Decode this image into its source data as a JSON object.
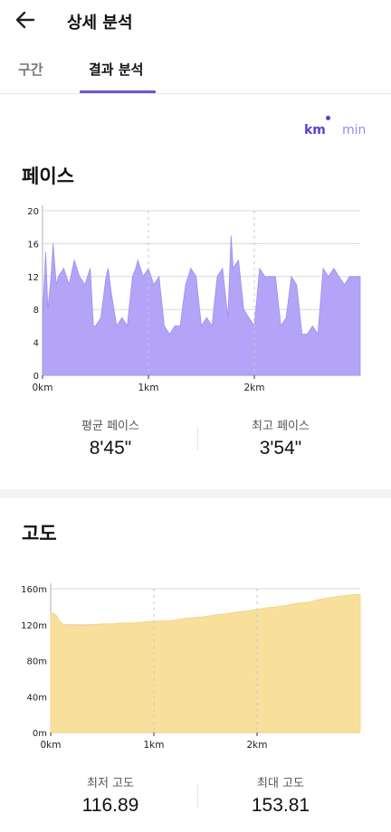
{
  "header": {
    "title": "상세 분석"
  },
  "tabs": [
    {
      "label": "구간",
      "selected": false
    },
    {
      "label": "결과 분석",
      "selected": true
    }
  ],
  "units": {
    "km": "km",
    "min": "min",
    "selected": "km"
  },
  "pace": {
    "title": "페이스",
    "avg_label": "평균 페이스",
    "avg_value": "8'45\"",
    "best_label": "최고 페이스",
    "best_value": "3'54\""
  },
  "elevation": {
    "title": "고도",
    "min_label": "최저 고도",
    "min_value": "116.89",
    "max_label": "최대 고도",
    "max_value": "153.81"
  },
  "colors": {
    "accent": "#6a55d8",
    "pace_fill": "#b4a4f7",
    "elevation_fill": "#f8e09c"
  },
  "chart_data": [
    {
      "type": "area",
      "title": "",
      "xlabel": "",
      "ylabel": "",
      "ylim": [
        0,
        20
      ],
      "xlim": [
        0,
        3.0
      ],
      "yticks": [
        "0",
        "4",
        "8",
        "12",
        "16",
        "20"
      ],
      "xticks": [
        "0km",
        "1km",
        "2km"
      ],
      "grid": true,
      "series": [
        {
          "x": [
            0.0,
            0.03,
            0.05,
            0.08,
            0.1,
            0.13,
            0.15,
            0.2,
            0.25,
            0.3,
            0.35,
            0.4,
            0.45,
            0.48,
            0.5,
            0.55,
            0.6,
            0.62,
            0.65,
            0.7,
            0.75,
            0.8,
            0.85,
            0.88,
            0.9,
            0.95,
            1.0,
            1.05,
            1.1,
            1.15,
            1.2,
            1.25,
            1.3,
            1.35,
            1.4,
            1.45,
            1.5,
            1.55,
            1.6,
            1.65,
            1.7,
            1.75,
            1.78,
            1.8,
            1.85,
            1.9,
            1.95,
            2.0,
            2.05,
            2.1,
            2.15,
            2.2,
            2.25,
            2.3,
            2.35,
            2.4,
            2.45,
            2.5,
            2.55,
            2.6,
            2.65,
            2.7,
            2.75,
            2.8,
            2.85,
            2.9,
            2.95,
            3.0
          ],
          "y": [
            7,
            15,
            8,
            12,
            16,
            11,
            12,
            13,
            11,
            14,
            12,
            11,
            13,
            6,
            6,
            7,
            12,
            13,
            10,
            6,
            7,
            6,
            12,
            13,
            14,
            12,
            13,
            11,
            12,
            6,
            5,
            6,
            6,
            11,
            13,
            12,
            6,
            7,
            6,
            12,
            13,
            7,
            17,
            13,
            14,
            8,
            7,
            6,
            13,
            12,
            12,
            12,
            6,
            7,
            12,
            11,
            5,
            5,
            6,
            5,
            13,
            12,
            13,
            12,
            11,
            12,
            12,
            12
          ]
        }
      ]
    },
    {
      "type": "area",
      "title": "",
      "xlabel": "",
      "ylabel": "",
      "ylim": [
        0,
        160
      ],
      "xlim": [
        0,
        3.0
      ],
      "yticks": [
        "0m",
        "40m",
        "80m",
        "120m",
        "160m"
      ],
      "xticks": [
        "0km",
        "1km",
        "2km"
      ],
      "grid": true,
      "series": [
        {
          "x": [
            0.0,
            0.05,
            0.1,
            0.15,
            0.2,
            0.3,
            0.4,
            0.5,
            0.6,
            0.7,
            0.8,
            0.9,
            1.0,
            1.1,
            1.2,
            1.3,
            1.4,
            1.5,
            1.6,
            1.7,
            1.8,
            1.9,
            2.0,
            2.1,
            2.2,
            2.3,
            2.4,
            2.5,
            2.6,
            2.7,
            2.8,
            2.9,
            3.0
          ],
          "y": [
            134,
            131,
            122,
            119,
            120,
            119,
            120,
            121,
            121,
            122,
            122,
            123,
            124,
            124,
            125,
            127,
            128,
            129,
            131,
            132,
            134,
            135,
            137,
            139,
            140,
            142,
            144,
            145,
            148,
            150,
            152,
            153,
            154
          ]
        }
      ]
    }
  ]
}
